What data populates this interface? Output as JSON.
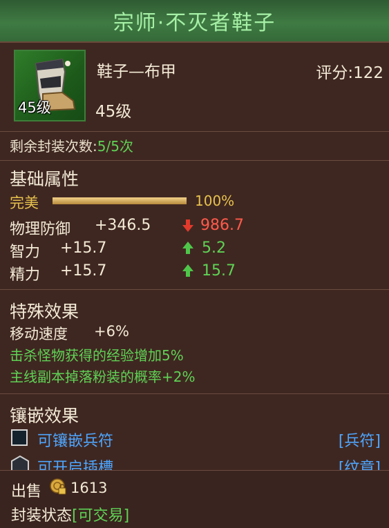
{
  "title": "宗师·不灭者鞋子",
  "item": {
    "icon": "boots-icon",
    "icon_level": "45级",
    "name": "鞋子—布甲",
    "score": "评分:122",
    "level": "45级"
  },
  "seal_count": {
    "label": "剩余封装次数:",
    "value": "5/5次"
  },
  "basic": {
    "header": "基础属性",
    "perfect_label": "完美",
    "perfect_fraction": 1.0,
    "perfect_text": "100%",
    "stats": [
      {
        "name": "物理防御",
        "value": "+346.5",
        "compare": "986.7",
        "direction": "down"
      },
      {
        "name": "智力",
        "value": "+15.7",
        "compare": "5.2",
        "direction": "up"
      },
      {
        "name": "精力",
        "value": "+15.7",
        "compare": "15.7",
        "direction": "up"
      }
    ]
  },
  "special": {
    "header": "特殊效果",
    "move_label": "移动速度",
    "move_value": "+6%",
    "effect1": "击杀怪物获得的经验增加5%",
    "effect2": "主线副本掉落粉装的概率+2%"
  },
  "inlay": {
    "header": "镶嵌效果",
    "socket1_label": "可镶嵌兵符",
    "socket1_tag": "[兵符]",
    "socket2_label": "可开启插槽",
    "socket2_tag": "[纹章]"
  },
  "footer": {
    "sale_label": "出售",
    "coin_icon": "gold-coin-lock-icon",
    "price": "1613",
    "bind_label": "封装状态",
    "bind_value": "[可交易]"
  },
  "colors": {
    "title_text": "#a6f0a6",
    "green": "#5fd255",
    "red": "#ff5a4a",
    "gold": "#e7c24e",
    "blue": "#4ea6ff",
    "background": "#3f2721"
  }
}
